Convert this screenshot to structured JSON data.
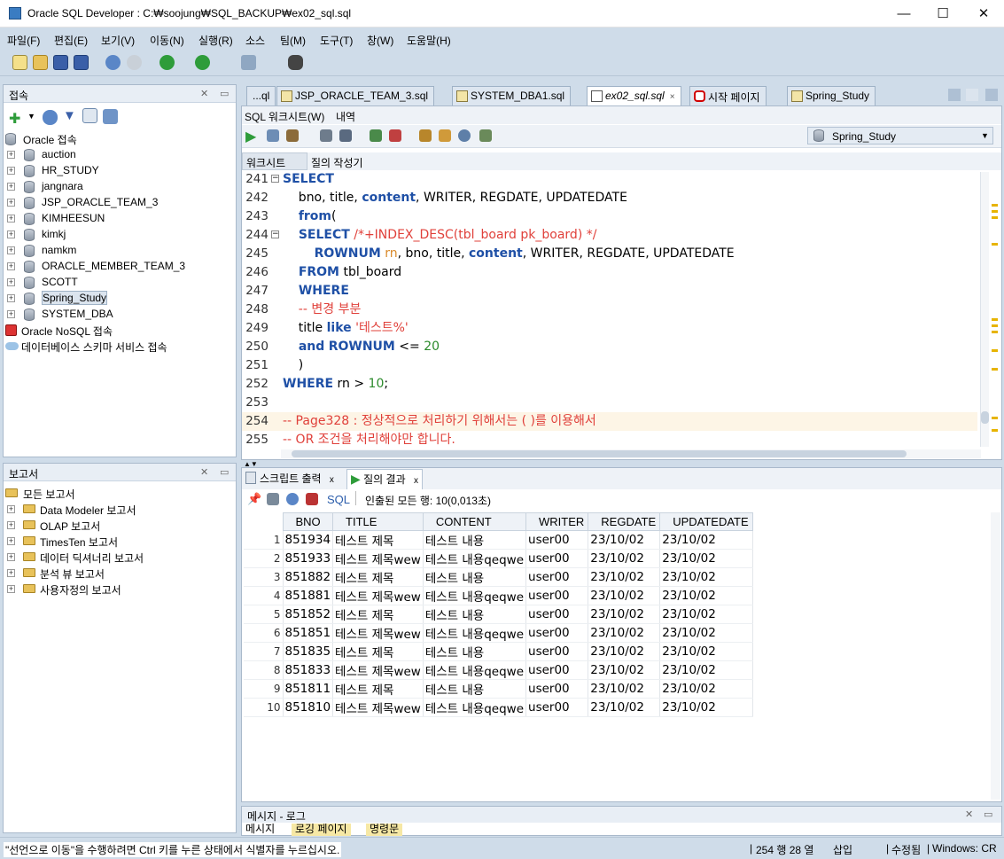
{
  "window": {
    "title": "Oracle SQL Developer : C:₩soojung₩SQL_BACKUP₩ex02_sql.sql",
    "minimize": "—",
    "maximize": "☐",
    "close": "✕"
  },
  "menu": [
    "파일(F)",
    "편집(E)",
    "보기(V)",
    "이동(N)",
    "실행(R)",
    "소스",
    "팀(M)",
    "도구(T)",
    "창(W)",
    "도움말(H)"
  ],
  "connections": {
    "title": "접속",
    "root": "Oracle 접속",
    "items": [
      "auction",
      "HR_STUDY",
      "jangnara",
      "JSP_ORACLE_TEAM_3",
      "KIMHEESUN",
      "kimkj",
      "namkm",
      "ORACLE_MEMBER_TEAM_3",
      "SCOTT",
      "Spring_Study",
      "SYSTEM_DBA"
    ],
    "nosql": "Oracle NoSQL 접속",
    "schema": "데이터베이스 스키마 서비스 접속"
  },
  "reports": {
    "title": "보고서",
    "root": "모든 보고서",
    "items": [
      "Data Modeler 보고서",
      "OLAP 보고서",
      "TimesTen 보고서",
      "데이터 딕셔너리 보고서",
      "분석 뷰 보고서",
      "사용자정의 보고서"
    ]
  },
  "tabs": [
    "...ql",
    "JSP_ORACLE_TEAM_3.sql",
    "SYSTEM_DBA1.sql",
    "ex02_sql.sql",
    "시작 페이지",
    "Spring_Study"
  ],
  "subtabs": {
    "worksheet": "SQL 워크시트(W)",
    "history": "내역"
  },
  "connection_select": "Spring_Study",
  "editor_tabs": {
    "worksheet": "워크시트",
    "query_builder": "질의 작성기"
  },
  "code_lines": [
    {
      "n": "241",
      "t": "SELECT"
    },
    {
      "n": "242",
      "t": "    bno, title, content, WRITER, REGDATE, UPDATEDATE"
    },
    {
      "n": "243",
      "t": "    from("
    },
    {
      "n": "244",
      "t": "    SELECT /*+INDEX_DESC(tbl_board pk_board) */"
    },
    {
      "n": "245",
      "t": "        ROWNUM rn, bno, title, content, WRITER, REGDATE, UPDATEDATE"
    },
    {
      "n": "246",
      "t": "    FROM tbl_board"
    },
    {
      "n": "247",
      "t": "    WHERE"
    },
    {
      "n": "248",
      "t": "    -- 변경 부분"
    },
    {
      "n": "249",
      "t": "    title like '테스트%'"
    },
    {
      "n": "250",
      "t": "    and ROWNUM <= 20"
    },
    {
      "n": "251",
      "t": "    )"
    },
    {
      "n": "252",
      "t": "WHERE rn > 10;"
    },
    {
      "n": "253",
      "t": ""
    },
    {
      "n": "254",
      "t": "-- Page328 : 정상적으로 처리하기 위해서는 ( )를 이용해서"
    },
    {
      "n": "255",
      "t": "-- OR 조건을 처리해야만 합니다."
    }
  ],
  "result_tabs": {
    "script": "스크립트 출력",
    "query": "질의 결과"
  },
  "result_toolbar": {
    "sql": "SQL",
    "fetched": "인출된 모든 행: 10(0,013초)"
  },
  "columns": [
    "BNO",
    "TITLE",
    "CONTENT",
    "WRITER",
    "REGDATE",
    "UPDATEDATE"
  ],
  "rows": [
    [
      "1",
      "851934",
      "테스트 제목",
      "테스트 내용",
      "user00",
      "23/10/02",
      "23/10/02"
    ],
    [
      "2",
      "851933",
      "테스트 제목wew",
      "테스트 내용qeqwe",
      "user00",
      "23/10/02",
      "23/10/02"
    ],
    [
      "3",
      "851882",
      "테스트 제목",
      "테스트 내용",
      "user00",
      "23/10/02",
      "23/10/02"
    ],
    [
      "4",
      "851881",
      "테스트 제목wew",
      "테스트 내용qeqwe",
      "user00",
      "23/10/02",
      "23/10/02"
    ],
    [
      "5",
      "851852",
      "테스트 제목",
      "테스트 내용",
      "user00",
      "23/10/02",
      "23/10/02"
    ],
    [
      "6",
      "851851",
      "테스트 제목wew",
      "테스트 내용qeqwe",
      "user00",
      "23/10/02",
      "23/10/02"
    ],
    [
      "7",
      "851835",
      "테스트 제목",
      "테스트 내용",
      "user00",
      "23/10/02",
      "23/10/02"
    ],
    [
      "8",
      "851833",
      "테스트 제목wew",
      "테스트 내용qeqwe",
      "user00",
      "23/10/02",
      "23/10/02"
    ],
    [
      "9",
      "851811",
      "테스트 제목",
      "테스트 내용",
      "user00",
      "23/10/02",
      "23/10/02"
    ],
    [
      "10",
      "851810",
      "테스트 제목wew",
      "테스트 내용qeqwe",
      "user00",
      "23/10/02",
      "23/10/02"
    ]
  ],
  "messages": {
    "title": "메시지 - 로그",
    "tabs": [
      "메시지",
      "로깅 페이지",
      "명령문"
    ]
  },
  "status": {
    "hint": "\"선언으로 이동\"을 수행하려면 Ctrl 키를 누른 상태에서 식별자를 누르십시오.",
    "position": "254 행 28 열",
    "mode": "삽입",
    "modified": "수정됨",
    "eol": "Windows: CR"
  }
}
